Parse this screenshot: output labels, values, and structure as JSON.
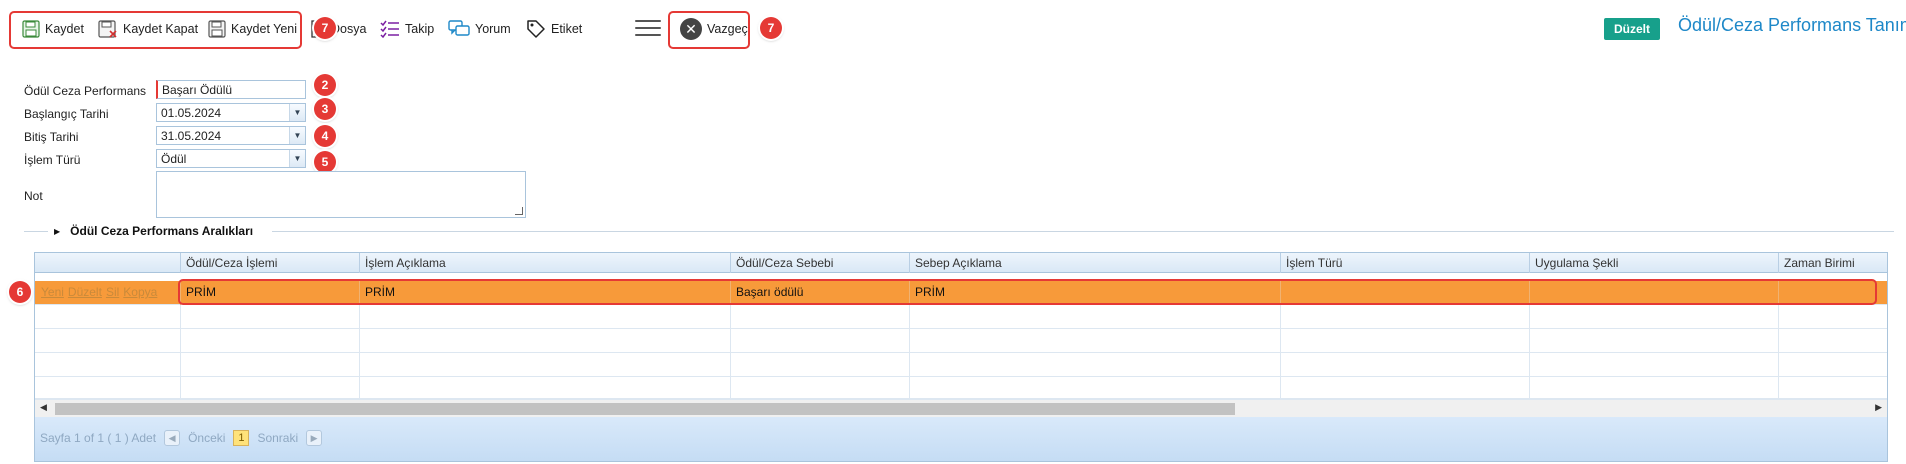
{
  "toolbar": {
    "save_label": "Kaydet",
    "save_close_label": "Kaydet Kapat",
    "save_new_label": "Kaydet Yeni",
    "file_label": "Dosya",
    "follow_label": "Takip",
    "comment_label": "Yorum",
    "tag_label": "Etiket",
    "cancel_label": "Vazgeç",
    "mode_badge": "Düzelt",
    "page_title": "Ödül/Ceza Performans Tanımı"
  },
  "annotations": {
    "toolbar_badge": "7",
    "cancel_badge": "7",
    "field1_badge": "2",
    "field2_badge": "3",
    "field3_badge": "4",
    "field4_badge": "5",
    "row_badge": "6"
  },
  "form": {
    "performance_label": "Ödül Ceza Performans",
    "performance_value": "Başarı Ödülü",
    "start_date_label": "Başlangıç Tarihi",
    "start_date_value": "01.05.2024",
    "end_date_label": "Bitiş Tarihi",
    "end_date_value": "31.05.2024",
    "type_label": "İşlem Türü",
    "type_value": "Ödül",
    "note_label": "Not",
    "note_value": ""
  },
  "section": {
    "title": "Ödül Ceza Performans Aralıkları"
  },
  "grid": {
    "columns": [
      "Ödül/Ceza İşlemi",
      "İşlem Açıklama",
      "Ödül/Ceza Sebebi",
      "Sebep Açıklama",
      "İşlem Türü",
      "Uygulama Şekli",
      "Zaman Birimi"
    ],
    "row_actions": [
      "Yeni",
      "Düzelt",
      "Sil",
      "Kopya"
    ],
    "rows": [
      [
        "PRİM",
        "PRİM",
        "Başarı ödülü",
        "PRİM",
        "",
        "",
        ""
      ]
    ],
    "pager": {
      "page_info": "Sayfa 1 of 1 ( 1 ) Adet",
      "prev_label": "Önceki",
      "current_page": "1",
      "next_label": "Sonraki"
    }
  },
  "colors": {
    "highlight": "#e53935",
    "selected_row": "#f79a3a",
    "accent": "#17a08b",
    "title": "#1e88c8"
  }
}
